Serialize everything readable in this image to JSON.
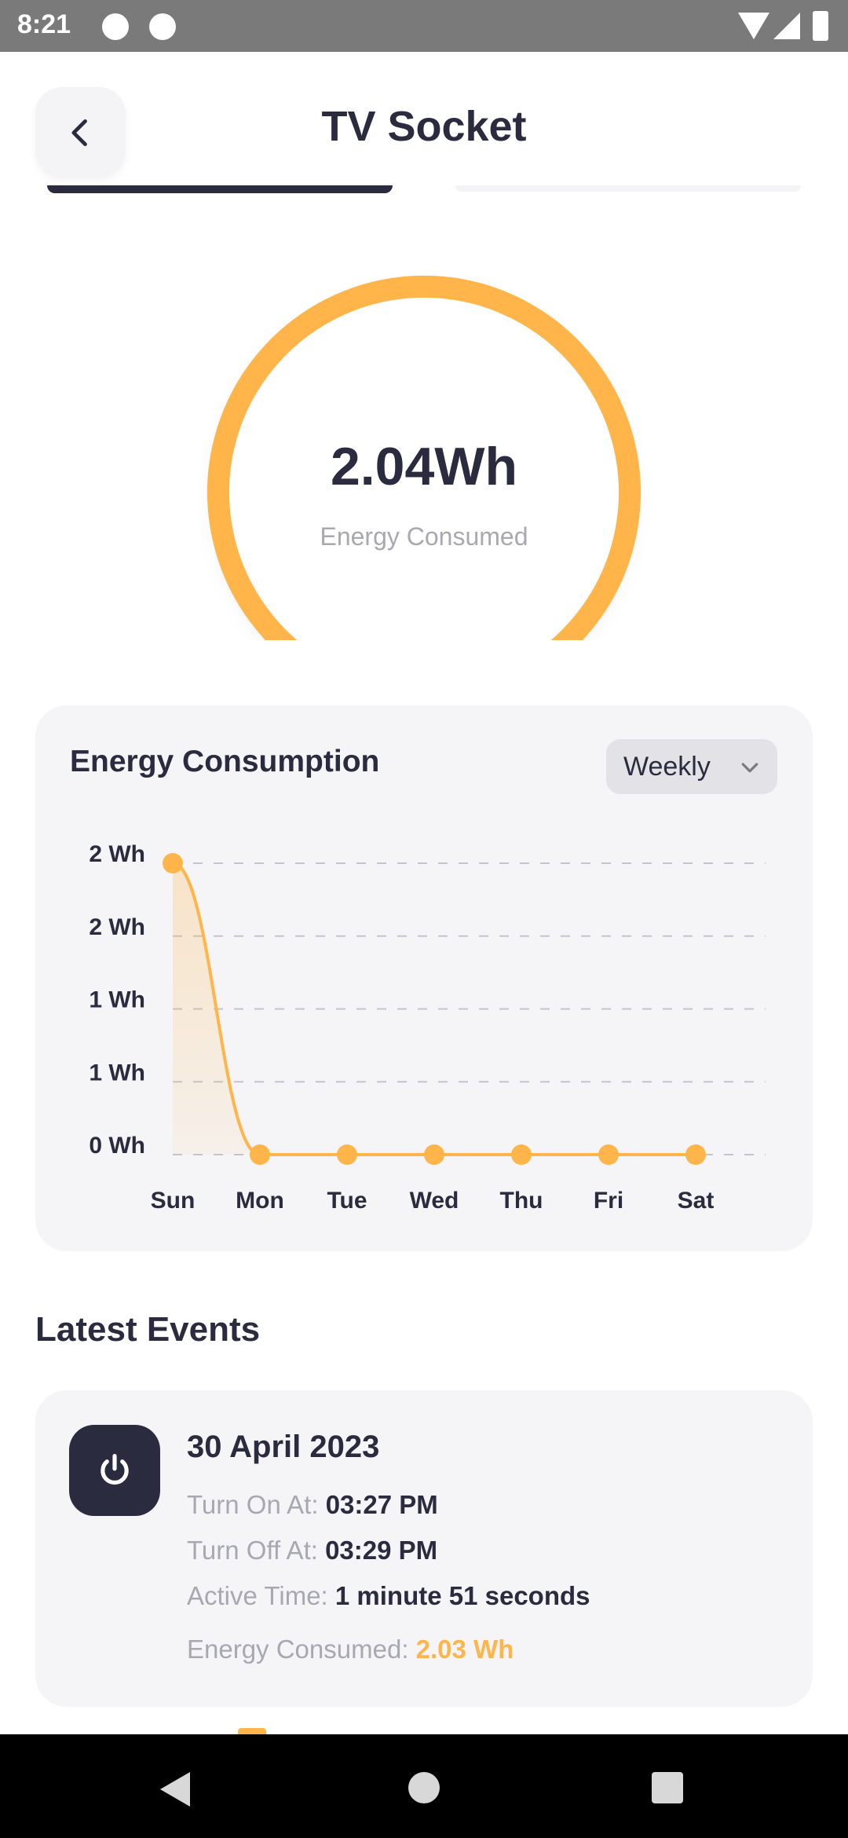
{
  "status_bar": {
    "time": "8:21"
  },
  "header": {
    "title": "TV Socket"
  },
  "gauge": {
    "value": "2.04Wh",
    "label": "Energy Consumed",
    "color": "#ffb54a"
  },
  "energy_chart": {
    "title": "Energy Consumption",
    "period_selected": "Weekly"
  },
  "chart_data": {
    "type": "line",
    "title": "Energy Consumption",
    "categories": [
      "Sun",
      "Mon",
      "Tue",
      "Wed",
      "Thu",
      "Fri",
      "Sat"
    ],
    "series": [
      {
        "values": [
          2.04,
          0,
          0,
          0,
          0,
          0,
          0
        ]
      }
    ],
    "y_tick_labels": [
      "2 Wh",
      "2 Wh",
      "1 Wh",
      "1 Wh",
      "0 Wh"
    ],
    "y_ticks": [
      2.04,
      1.53,
      1.02,
      0.51,
      0
    ],
    "ylim": [
      0,
      2.04
    ],
    "grid": "dashed horizontal",
    "line_color": "#ffb54a",
    "area_fill": true
  },
  "events": {
    "title": "Latest Events",
    "items": [
      {
        "date": "30 April 2023",
        "turn_on_label": "Turn On At:",
        "turn_on_value": "03:27 PM",
        "turn_off_label": "Turn Off At:",
        "turn_off_value": "03:29 PM",
        "active_label": "Active Time:",
        "active_value": "1 minute 51 seconds",
        "energy_label": "Energy Consumed:",
        "energy_value": "2.03 Wh"
      }
    ]
  },
  "colors": {
    "accent": "#ffb54a",
    "dark": "#2b2b3f",
    "card": "#f5f5f8",
    "muted": "#a8a8b0"
  }
}
